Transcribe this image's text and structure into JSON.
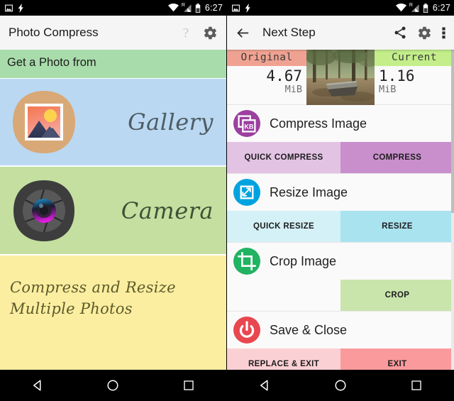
{
  "status_bar": {
    "icons": [
      "image-icon",
      "charging-bolt-icon",
      "wifi-icon",
      "roaming-signal-icon",
      "battery-icon"
    ],
    "roaming_label": "R",
    "time": "6:27"
  },
  "left_screen": {
    "appbar": {
      "title": "Photo Compress",
      "help_icon": "question-mark-icon",
      "settings_icon": "gear-icon"
    },
    "section_header": "Get a Photo from",
    "options": [
      {
        "label": "Gallery",
        "icon": "gallery-app-icon",
        "bg": "#bad8f2"
      },
      {
        "label": "Camera",
        "icon": "camera-app-icon",
        "bg": "#c4dfa0"
      }
    ],
    "footer_text": "Compress and Resize Multiple Photos",
    "colors": {
      "header_bg": "#a9dcab",
      "gallery_bg": "#bad8f2",
      "camera_bg": "#c4dfa0",
      "footer_bg": "#fbeea0"
    }
  },
  "right_screen": {
    "appbar": {
      "back_icon": "back-arrow-icon",
      "title": "Next Step",
      "share_icon": "share-icon",
      "settings_icon": "gear-icon",
      "overflow_icon": "overflow-menu-icon"
    },
    "size_compare": {
      "original": {
        "label": "Original",
        "value": "4.67",
        "unit": "MiB",
        "badge_color": "#f0a292"
      },
      "current": {
        "label": "Current",
        "value": "1.16",
        "unit": "MiB",
        "badge_color": "#c3ee8a"
      },
      "thumbnail": "photo-thumbnail"
    },
    "actions": [
      {
        "title": "Compress Image",
        "icon": "compress-kb-icon",
        "icon_color": "#9b3fa0",
        "buttons": [
          {
            "label": "QUICK COMPRESS",
            "bg": "#e3c3e3"
          },
          {
            "label": "COMPRESS",
            "bg": "#c98fcc"
          }
        ]
      },
      {
        "title": "Resize Image",
        "icon": "resize-arrows-icon",
        "icon_color": "#00a3e0",
        "buttons": [
          {
            "label": "QUICK RESIZE",
            "bg": "#d4f1f7"
          },
          {
            "label": "RESIZE",
            "bg": "#a9e3f0"
          }
        ]
      },
      {
        "title": "Crop Image",
        "icon": "crop-icon",
        "icon_color": "#21b361",
        "buttons": [
          {
            "label": "",
            "bg": "#fafafa"
          },
          {
            "label": "CROP",
            "bg": "#c9e5ac"
          }
        ]
      },
      {
        "title": "Save & Close",
        "icon": "power-icon",
        "icon_color": "#e8474f",
        "buttons": [
          {
            "label": "REPLACE & EXIT",
            "bg": "#fbd0d4"
          },
          {
            "label": "EXIT",
            "bg": "#fa9a9d"
          }
        ]
      }
    ]
  },
  "nav_bar": {
    "back": "nav-back-triangle-icon",
    "home": "nav-home-circle-icon",
    "recents": "nav-recents-square-icon"
  }
}
